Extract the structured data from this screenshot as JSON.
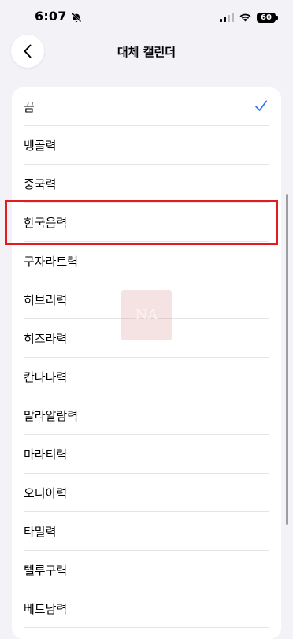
{
  "status_bar": {
    "time": "6:07",
    "battery": "60"
  },
  "nav": {
    "title": "대체 캘린더"
  },
  "calendars": [
    {
      "label": "끔",
      "selected": true
    },
    {
      "label": "벵골력",
      "selected": false
    },
    {
      "label": "중국력",
      "selected": false
    },
    {
      "label": "한국음력",
      "selected": false,
      "highlighted": true
    },
    {
      "label": "구자라트력",
      "selected": false
    },
    {
      "label": "히브리력",
      "selected": false
    },
    {
      "label": "히즈라력",
      "selected": false
    },
    {
      "label": "칸나다력",
      "selected": false
    },
    {
      "label": "말라얄람력",
      "selected": false
    },
    {
      "label": "마라티력",
      "selected": false
    },
    {
      "label": "오디아력",
      "selected": false
    },
    {
      "label": "타밀력",
      "selected": false
    },
    {
      "label": "텔루구력",
      "selected": false
    },
    {
      "label": "베트남력",
      "selected": false
    }
  ],
  "watermark": {
    "text": "NA"
  },
  "colors": {
    "accent": "#3478f6",
    "highlight_border": "#e31b1b",
    "background": "#f2f2f7"
  },
  "icons": [
    "back-chevron-icon",
    "bell-slash-icon",
    "cellular-signal-icon",
    "wifi-icon",
    "battery-icon",
    "checkmark-icon"
  ]
}
